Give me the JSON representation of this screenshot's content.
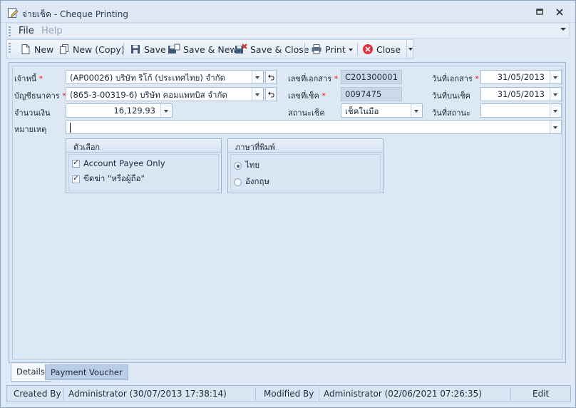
{
  "window": {
    "title": "จ่ายเช็ค - Cheque Printing"
  },
  "menu": {
    "file": "File",
    "help": "Help"
  },
  "toolbar": {
    "new": "New",
    "new_copy": "New (Copy)",
    "save": "Save",
    "save_new": "Save & New",
    "save_close": "Save & Close",
    "print": "Print",
    "close": "Close"
  },
  "form": {
    "creditor_label": "เจ้าหนี้",
    "creditor_value": "(AP00026) บริษัท ริโก้ (ประเทศไทย) จำกัด",
    "bank_account_label": "บัญชีธนาคาร",
    "bank_account_value": "(865-3-00319-6) บริษัท คอมแพทบิส จำกัด",
    "amount_label": "จำนวนเงิน",
    "amount_value": "16,129.93",
    "remark_label": "หมายเหตุ",
    "remark_value": "",
    "doc_no_label": "เลขที่เอกสาร",
    "doc_no_value": "C201300001",
    "cheque_no_label": "เลขที่เช็ค",
    "cheque_no_value": "0097475",
    "cheque_status_label": "สถานะเช็ค",
    "cheque_status_value": "เช็คในมือ",
    "doc_date_label": "วันที่เอกสาร",
    "doc_date_value": "31/05/2013",
    "cheque_date_label": "วันที่บนเช็ค",
    "cheque_date_value": "31/05/2013",
    "status_date_label": "วันที่สถานะ",
    "status_date_value": "",
    "required_mark": "*"
  },
  "options": {
    "title": "ตัวเลือก",
    "account_payee_only": "Account Payee Only",
    "strike_bearer": "ขีดฆ่า \"หรือผู้ถือ\"",
    "account_payee_only_checked": true,
    "strike_bearer_checked": true
  },
  "print_language": {
    "title": "ภาษาที่พิมพ์",
    "thai": "ไทย",
    "english": "อังกฤษ",
    "selected": "ไทย"
  },
  "tabs": [
    {
      "label": "Details",
      "active": true
    },
    {
      "label": "Payment Voucher",
      "active": false
    }
  ],
  "status": {
    "created_by_label": "Created By",
    "created_by_value": "Administrator (30/07/2013 17:38:14)",
    "modified_by_label": "Modified By",
    "modified_by_value": "Administrator (02/06/2021 07:26:35)",
    "edit": "Edit"
  },
  "icons": [
    "edit-document-icon",
    "restore-icon",
    "close-icon",
    "new-document-icon",
    "copy-icon",
    "save-icon",
    "save-new-icon",
    "save-close-icon",
    "printer-icon",
    "close-circle-icon",
    "undo-icon"
  ],
  "colors": {
    "close_red": "#e0303a",
    "required_red": "#e02020",
    "accent_blue": "#2f5da8"
  }
}
